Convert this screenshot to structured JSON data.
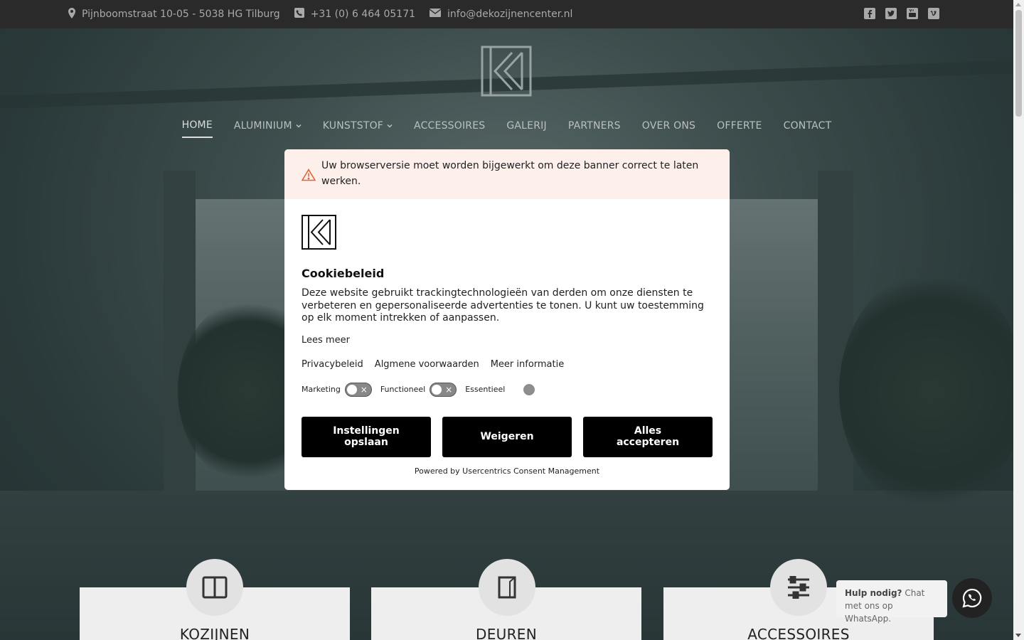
{
  "topbar": {
    "address": "Pijnboomstraat 10-05 - 5038 HG Tilburg",
    "phone": "+31 (0) 6 464 05171",
    "email": "info@dekozijnencenter.nl",
    "social": [
      "facebook-icon",
      "twitter-icon",
      "youtube-icon",
      "vimeo-icon"
    ]
  },
  "nav": {
    "items": [
      {
        "label": "HOME",
        "active": true,
        "dropdown": false
      },
      {
        "label": "ALUMINIUM",
        "dropdown": true
      },
      {
        "label": "KUNSTSTOF",
        "dropdown": true
      },
      {
        "label": "ACCESSOIRES",
        "dropdown": false
      },
      {
        "label": "GALERIJ",
        "dropdown": false
      },
      {
        "label": "PARTNERS",
        "dropdown": false
      },
      {
        "label": "OVER ONS",
        "dropdown": false
      },
      {
        "label": "OFFERTE",
        "dropdown": false
      },
      {
        "label": "CONTACT",
        "dropdown": false
      }
    ]
  },
  "cards": [
    {
      "title": "KOZIJNEN",
      "icon": "window-icon"
    },
    {
      "title": "DEUREN",
      "icon": "door-icon"
    },
    {
      "title": "ACCESSOIRES",
      "icon": "sliders-icon"
    }
  ],
  "whatsapp": {
    "bold": "Hulp nodig?",
    "text": " Chat met ons op WhatsApp."
  },
  "cookie": {
    "warning": "Uw browserversie moet worden bijgewerkt om deze banner correct te laten werken.",
    "title": "Cookiebeleid",
    "text": "Deze website gebruikt trackingtechnologieën van derden om onze diensten te verbeteren en gepersonaliseerde advertenties te tonen. U kunt uw toestemming op elk moment intrekken of aanpassen.",
    "read_more": "Lees meer",
    "links": [
      "Privacybeleid",
      "Algmene voorwaarden",
      "Meer informatie"
    ],
    "toggles": {
      "marketing": "Marketing",
      "functional": "Functioneel",
      "essential": "Essentieel"
    },
    "buttons": {
      "save": "Instellingen opslaan",
      "deny": "Weigeren",
      "accept": "Alles accepteren"
    },
    "powered": "Powered by Usercentrics Consent Management"
  },
  "colors": {
    "topbar": "#2a2a2a",
    "button": "#000000",
    "warning_bg": "#fdf0eb"
  }
}
